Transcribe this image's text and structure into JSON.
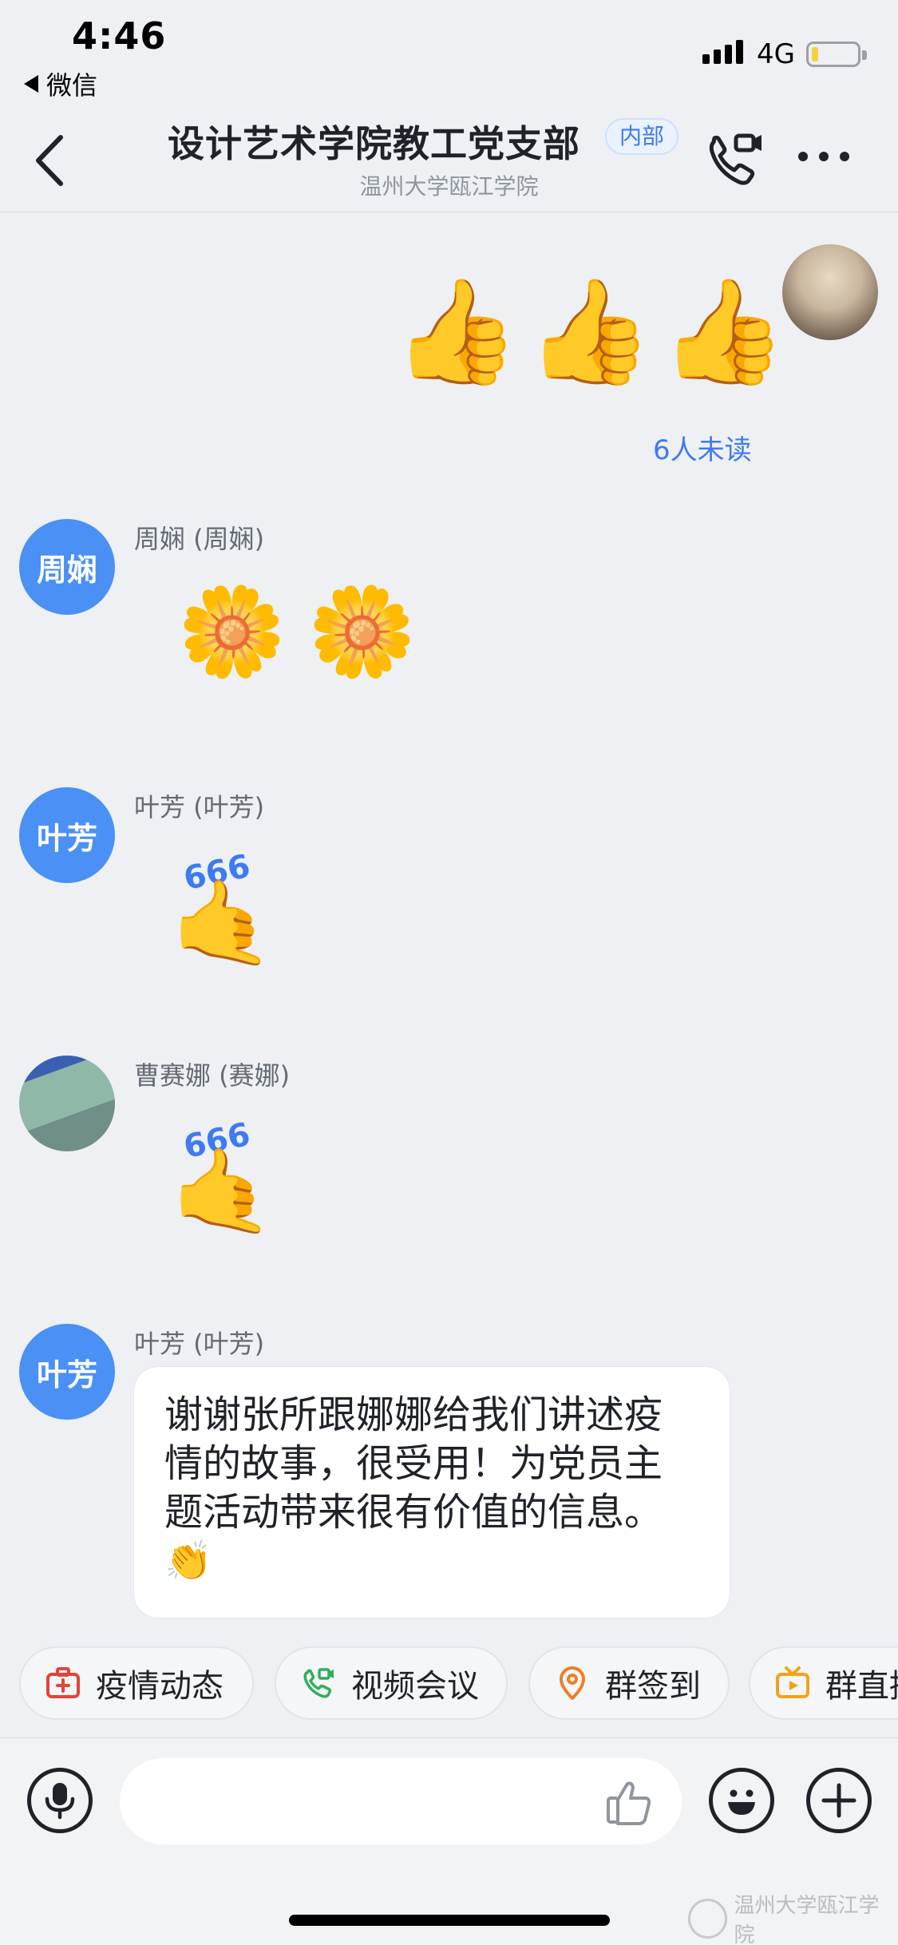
{
  "status_bar": {
    "time": "4:46",
    "back_app_label": "微信",
    "network": "4G",
    "battery_fraction": 0.1
  },
  "header": {
    "title": "设计艺术学院教工党支部",
    "badge": "内部",
    "subtitle": "温州大学瓯江学院"
  },
  "messages": [
    {
      "sender": "",
      "content": "👍👍👍",
      "outgoing": true,
      "read_status": "6人未读"
    },
    {
      "avatar_text": "周娴",
      "sender": "周娴 (周娴)",
      "content": "🌼🌼"
    },
    {
      "avatar_text": "叶芳",
      "sender": "叶芳 (叶芳)",
      "content": "🤙"
    },
    {
      "avatar_text": "",
      "sender": "曹赛娜 (赛娜)",
      "content": "🤙"
    },
    {
      "avatar_text": "叶芳",
      "sender": "叶芳 (叶芳)",
      "content": "谢谢张所跟娜娜给我们讲述疫情的故事，很受用！为党员主题活动带来很有价值的信息。👏"
    }
  ],
  "sticker_label": "666",
  "quick_actions": [
    "疫情动态",
    "视频会议",
    "群签到",
    "群直播"
  ],
  "colors": {
    "accent_blue": "#3e7bf0",
    "avatar_blue": "#4a90f5",
    "background": "#eef0f3"
  },
  "icons": [
    "back-arrow-icon",
    "video-call-icon",
    "more-icon",
    "medical-kit-icon",
    "video-meeting-icon",
    "location-pin-icon",
    "live-tv-icon",
    "microphone-icon",
    "thumbs-up-icon",
    "smiley-icon",
    "plus-icon"
  ],
  "watermark": "温州大学瓯江学院"
}
